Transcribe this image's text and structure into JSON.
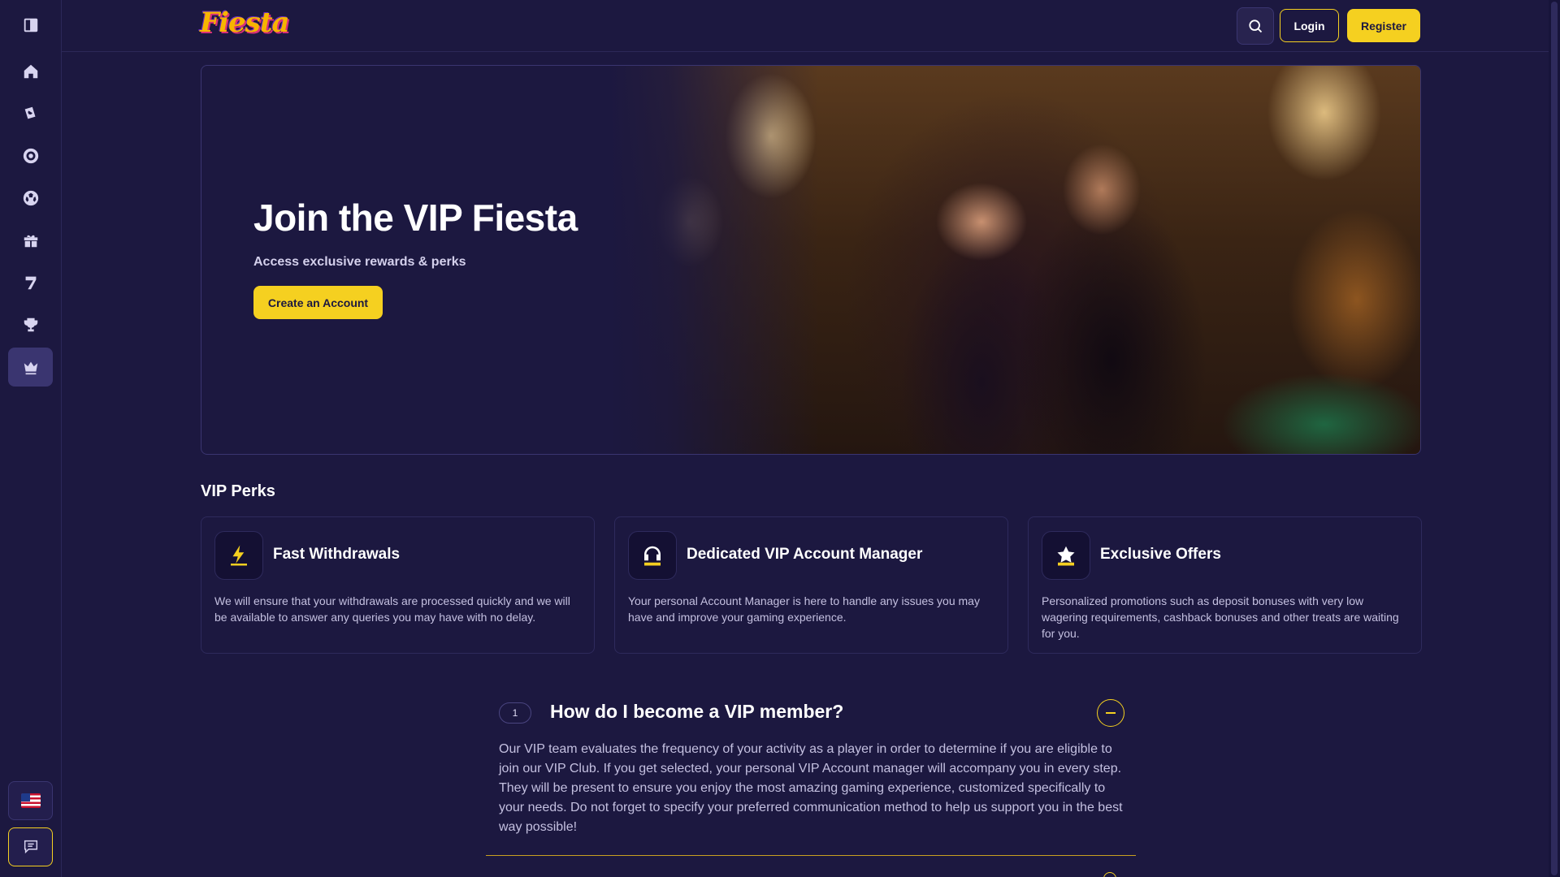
{
  "brand": {
    "logo_text": "Fiesta",
    "accent": "#f5d020",
    "bg": "#1c1840"
  },
  "sidebar": {
    "items": [
      {
        "name": "sidebar-toggle",
        "icon": "panel-toggle-icon"
      },
      {
        "name": "home",
        "icon": "home-icon"
      },
      {
        "name": "casino",
        "icon": "casino-chip-icon"
      },
      {
        "name": "live-casino",
        "icon": "roulette-icon"
      },
      {
        "name": "sports",
        "icon": "soccer-ball-icon"
      },
      {
        "name": "promotions",
        "icon": "gift-icon"
      },
      {
        "name": "slots",
        "icon": "lucky-seven-icon"
      },
      {
        "name": "tournaments",
        "icon": "trophy-icon"
      },
      {
        "name": "vip",
        "icon": "crown-icon",
        "active": true
      }
    ],
    "language_icon": "us-flag-icon",
    "chat_icon": "chat-icon"
  },
  "header": {
    "login_label": "Login",
    "register_label": "Register",
    "search_icon": "search-icon"
  },
  "hero": {
    "title": "Join the VIP Fiesta",
    "subtitle": "Access exclusive rewards & perks",
    "cta_label": "Create an Account"
  },
  "perks": {
    "section_title": "VIP Perks",
    "items": [
      {
        "icon": "lightning-icon",
        "title": "Fast Withdrawals",
        "description": "We will ensure that your withdrawals are processed quickly and we will be available to answer any queries you may have with no delay."
      },
      {
        "icon": "headset-icon",
        "title": "Dedicated VIP Account Manager",
        "description": "Your personal Account Manager is here to handle any issues you may have and improve your gaming experience."
      },
      {
        "icon": "star-icon",
        "title": "Exclusive Offers",
        "description": "Personalized promotions such as deposit bonuses with very low wagering requirements, cashback bonuses and other treats are waiting for you."
      }
    ]
  },
  "faq": {
    "items": [
      {
        "number": "1",
        "question": "How do I become a VIP member?",
        "answer": "Our VIP team evaluates the frequency of your activity as a player in order to determine if you are eligible to join our VIP Club. If you get selected, your personal VIP Account manager will accompany you in every step. They will be present to ensure you enjoy the most amazing gaming experience, customized specifically to your needs. Do not forget to specify your preferred communication method to help us support you in the best way possible!",
        "expanded": true
      }
    ]
  }
}
